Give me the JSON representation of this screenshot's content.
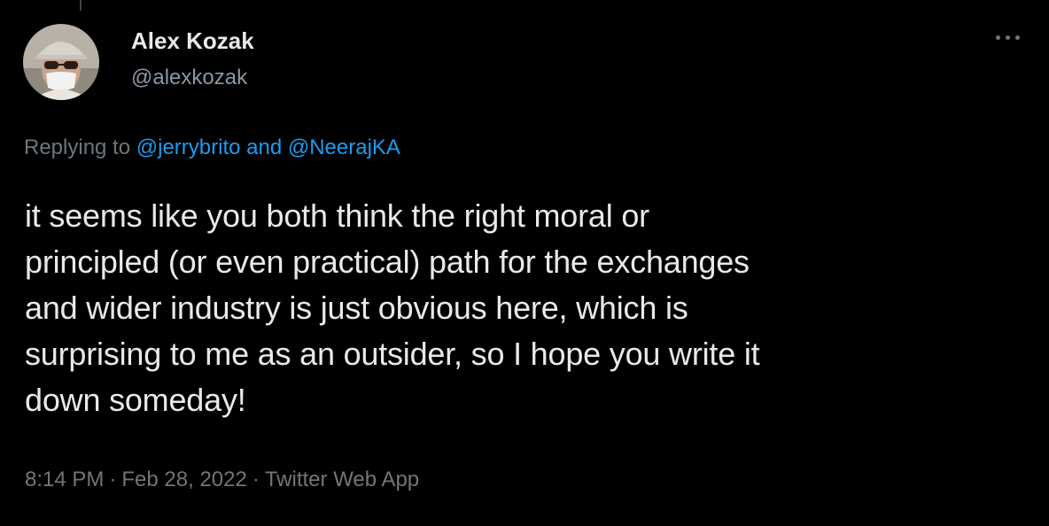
{
  "author": {
    "display_name": "Alex Kozak",
    "handle": "@alexkozak"
  },
  "reply": {
    "prefix": "Replying to ",
    "mentions": [
      "@jerrybrito",
      "@NeerajKA"
    ],
    "joiner": " and "
  },
  "tweet": {
    "text": "it seems like you both think the right moral or\nprincipled (or even practical) path for the exchanges\nand wider industry is just obvious here, which is\nsurprising to me as an outsider, so I hope you write it\ndown someday!"
  },
  "meta": {
    "time": "8:14 PM",
    "date": "Feb 28, 2022",
    "source": "Twitter Web App",
    "separator": "·"
  },
  "icons": {
    "more": "more-horizontal-icon"
  },
  "colors": {
    "background": "#000000",
    "link": "#1d9bf0",
    "secondary": "#6e767d",
    "primary_text": "#e7e9ea"
  }
}
